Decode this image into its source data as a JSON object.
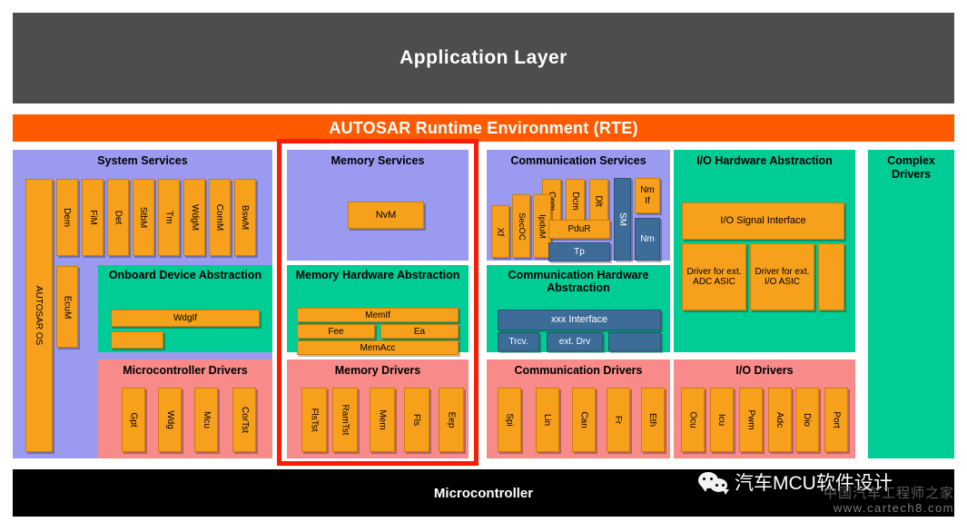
{
  "app_layer": {
    "label": "Application Layer"
  },
  "rte": {
    "label": "AUTOSAR Runtime Environment (RTE)"
  },
  "microcontroller": {
    "label": "Microcontroller"
  },
  "colors": {
    "application_layer": "#4d4d4d",
    "rte": "#ff5a00",
    "services": "#9a9bf0",
    "hardware_abstraction": "#00cc96",
    "drivers": "#f98a8a",
    "module_chip": "#f7a01c",
    "module_chip_blue": "#3d6c99",
    "microcontroller": "#000000",
    "highlight": "#ff1a00"
  },
  "columns": {
    "system": {
      "services_title": "System Services",
      "abstraction_title": "Onboard Device Abstraction",
      "drivers_title": "Microcontroller Drivers",
      "os": "AUTOSAR OS",
      "ecum": "EcuM",
      "service_modules": [
        "Dem",
        "FiM",
        "Det",
        "StbM",
        "Tm",
        "WdgM",
        "ComM",
        "BswM"
      ],
      "abstraction_modules": [
        "WdgIf",
        ""
      ],
      "driver_modules": [
        "Gpt",
        "Wdg",
        "Mcu",
        "CorTst"
      ]
    },
    "memory": {
      "services_title": "Memory Services",
      "abstraction_title": "Memory Hardware Abstraction",
      "drivers_title": "Memory Drivers",
      "service_modules": [
        "NvM"
      ],
      "abstraction_modules": [
        "MemIf",
        "Fee",
        "Ea",
        "MemAcc"
      ],
      "driver_modules": [
        "FlsTst",
        "RamTst",
        "Mem",
        "Fls",
        "Eep"
      ]
    },
    "communication": {
      "services_title": "Communication Services",
      "abstraction_title": "Communication Hardware Abstraction",
      "drivers_title": "Communication Drivers",
      "service_modules_top": [
        "Com",
        "Dcm",
        "Dlt"
      ],
      "service_modules_left": [
        "Xf",
        "SecOC",
        "IpduM"
      ],
      "pdur": "PduR",
      "tp": "Tp",
      "sm": "SM",
      "nmif_line1": "Nm",
      "nmif_line2": "If",
      "nm": "Nm",
      "abstraction_interface": "xxx Interface",
      "abstraction_trcv": "Trcv.",
      "abstraction_extdrv": "ext. Drv",
      "driver_modules": [
        "Spi",
        "Lin",
        "Can",
        "Fr",
        "Eth"
      ]
    },
    "io": {
      "abstraction_title": "I/O Hardware Abstraction",
      "drivers_title": "I/O Drivers",
      "signal_interface": "I/O Signal Interface",
      "driver_ext_adc": "Driver for ext. ADC ASIC",
      "driver_ext_io": "Driver for ext. I/O ASIC",
      "driver_modules": [
        "Ocu",
        "Icu",
        "Pwm",
        "Adc",
        "Dio",
        "Port"
      ]
    },
    "complex": {
      "title_line1": "Complex",
      "title_line2": "Drivers"
    }
  },
  "watermark": {
    "account_name": "汽车MCU软件设计",
    "overlay_text": "中国汽车工程师之家",
    "url": "www.cartech8.com",
    "icon": "wechat-icon"
  }
}
